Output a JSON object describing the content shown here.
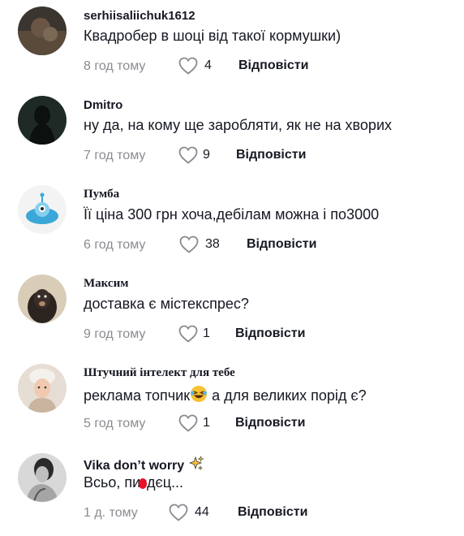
{
  "colors": {
    "text": "#161823",
    "muted": "#8a8b91",
    "background": "#ffffff"
  },
  "comments": [
    {
      "username": "serhiisaliichuk1612",
      "text": "Квадробер в шоці від такої кормушки)",
      "time": "8 год тому",
      "likes": "4",
      "reply": "Відповісти"
    },
    {
      "username": "Dmitro",
      "text": "ну да, на кому ще заробляти, як не на хворих",
      "time": "7 год тому",
      "likes": "9",
      "reply": "Відповісти"
    },
    {
      "username": "Пумба",
      "text": "Її ціна 300 грн хоча,дебілам можна і по3000",
      "time": "6 год тому",
      "likes": "38",
      "reply": "Відповісти"
    },
    {
      "username": "Максим",
      "text": "доставка є містекспрес?",
      "time": "9 год тому",
      "likes": "1",
      "reply": "Відповісти"
    },
    {
      "username": "Штучний інтелект для тебе",
      "text_before": "реклама топчик",
      "text_after": " а для великих порід є?",
      "time": "5 год тому",
      "likes": "1",
      "reply": "Відповісти"
    },
    {
      "username": "Vika don’t worry",
      "text": "Всьо, пиздєц...",
      "time": "1 д. тому",
      "likes": "44",
      "reply": "Відповісти"
    }
  ]
}
